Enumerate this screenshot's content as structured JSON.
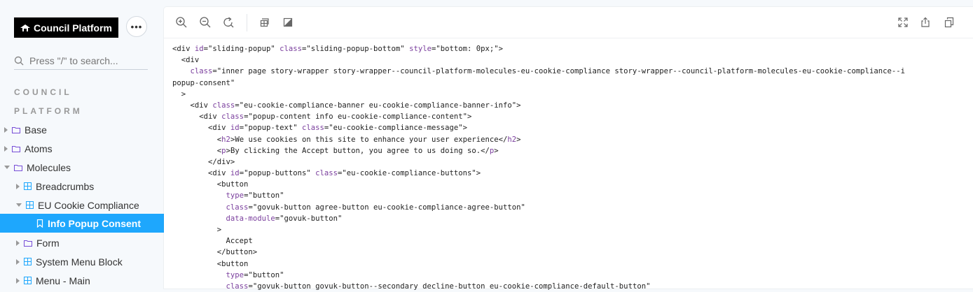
{
  "sidebar": {
    "brand": "Council Platform",
    "menu_label": "•••",
    "search_placeholder": "Press \"/\" to search...",
    "section_lines": [
      "COUNCIL",
      "PLATFORM"
    ],
    "items": [
      {
        "label": "Base"
      },
      {
        "label": "Atoms"
      },
      {
        "label": "Molecules"
      },
      {
        "label": "Breadcrumbs"
      },
      {
        "label": "EU Cookie Compliance"
      },
      {
        "label": "Info Popup Consent"
      },
      {
        "label": "Form"
      },
      {
        "label": "System Menu Block"
      },
      {
        "label": "Menu - Main"
      }
    ]
  },
  "code_lines": [
    "<div id=\"sliding-popup\" class=\"sliding-popup-bottom\" style=\"bottom: 0px;\">",
    "  <div",
    "    class=\"inner page story-wrapper story-wrapper--council-platform-molecules-eu-cookie-compliance story-wrapper--council-platform-molecules-eu-cookie-compliance--i",
    "popup-consent\"",
    "  >",
    "    <div class=\"eu-cookie-compliance-banner eu-cookie-compliance-banner-info\">",
    "      <div class=\"popup-content info eu-cookie-compliance-content\">",
    "        <div id=\"popup-text\" class=\"eu-cookie-compliance-message\">",
    "          <h2>We use cookies on this site to enhance your user experience</h2>",
    "          <p>By clicking the Accept button, you agree to us doing so.</p>",
    "        </div>",
    "        <div id=\"popup-buttons\" class=\"eu-cookie-compliance-buttons\">",
    "          <button",
    "            type=\"button\"",
    "            class=\"govuk-button agree-button eu-cookie-compliance-agree-button\"",
    "            data-module=\"govuk-button\"",
    "          >",
    "            Accept",
    "          </button>",
    "          <button",
    "            type=\"button\"",
    "            class=\"govuk-button govuk-button--secondary decline-button eu-cookie-compliance-default-button\""
  ]
}
